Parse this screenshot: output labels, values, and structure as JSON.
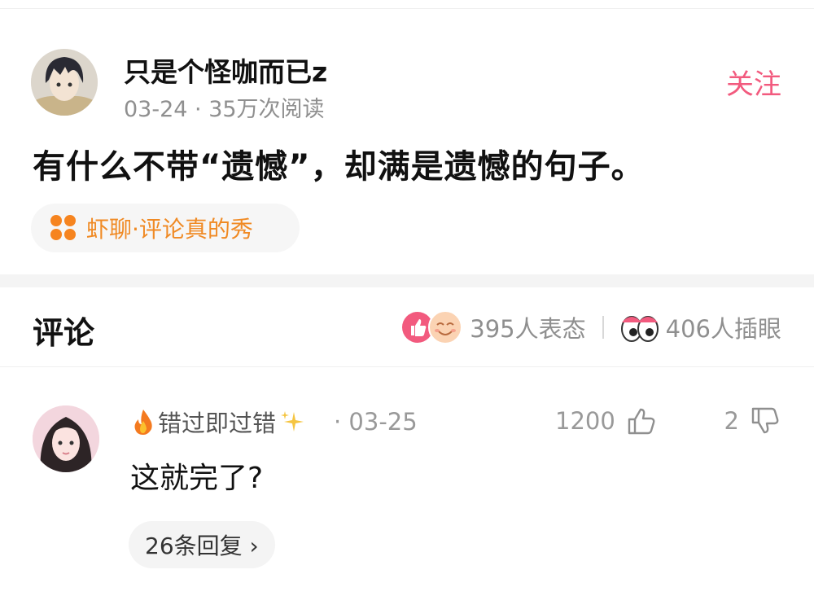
{
  "post": {
    "author": "只是个怪咖而已z",
    "meta": "03-24 · 35万次阅读",
    "follow_label": "关注",
    "title": "有什么不带“遗憾”，却满是遗憾的句子。",
    "topic_tag": "虾聊·评论真的秀"
  },
  "comments_section": {
    "heading": "评论",
    "reactions_count": "395人表态",
    "eyes_count": "406人插眼"
  },
  "comment": {
    "author": "错过即过错",
    "date": "· 03-25",
    "likes": "1200",
    "dislikes": "2",
    "text": "这就完了?",
    "replies_label": "26条回复 ›"
  },
  "colors": {
    "accent_pink": "#f25a7e",
    "topic_orange": "#f08a24",
    "meta_gray": "#8f8f8f"
  },
  "icons": [
    "fire-icon",
    "sparkle-icon",
    "thumb-up-icon",
    "thumb-down-icon",
    "like-reaction-icon",
    "smile-reaction-icon",
    "eyes-icon",
    "topic-dots-icon"
  ]
}
